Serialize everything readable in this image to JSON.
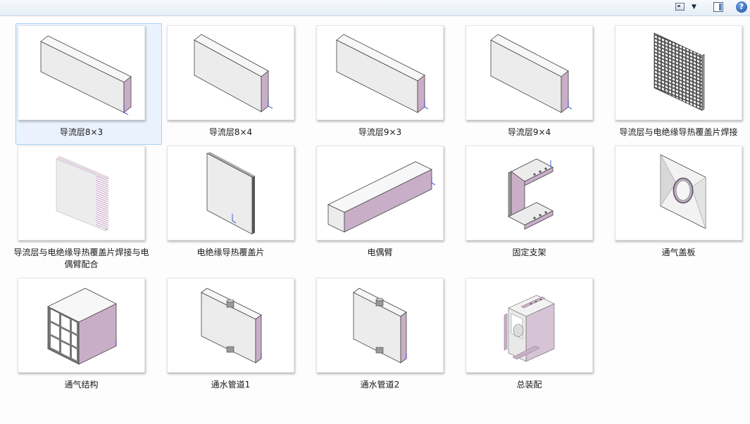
{
  "toolbar": {
    "view_icon": "views-icon",
    "dropdown_icon": "chevron-down-icon",
    "pane_icon": "preview-pane-icon",
    "help_icon": "help-icon",
    "help_text": "?"
  },
  "files": [
    {
      "name": "导流层8×3",
      "icon": "panel-thumbnail",
      "selected": true
    },
    {
      "name": "导流层8×4",
      "icon": "panel-thumbnail"
    },
    {
      "name": "导流层9×3",
      "icon": "panel-thumbnail"
    },
    {
      "name": "导流层9×4",
      "icon": "panel-thumbnail"
    },
    {
      "name": "导流层与电绝缘导热覆盖片焊接",
      "icon": "grid-panel-thumbnail"
    },
    {
      "name": "导流层与电绝缘导热覆盖片焊接与电偶臂配合",
      "icon": "stacked-panel-thumbnail"
    },
    {
      "name": "电绝缘导热覆盖片",
      "icon": "thin-plate-thumbnail"
    },
    {
      "name": "电偶臂",
      "icon": "long-bar-thumbnail"
    },
    {
      "name": "固定支架",
      "icon": "bracket-thumbnail"
    },
    {
      "name": "通气盖板",
      "icon": "vent-cover-thumbnail"
    },
    {
      "name": "通气结构",
      "icon": "vent-structure-thumbnail"
    },
    {
      "name": "通水管道1",
      "icon": "water-pipe-thumbnail"
    },
    {
      "name": "通水管道2",
      "icon": "water-pipe-thumbnail"
    },
    {
      "name": "总装配",
      "icon": "assembly-thumbnail"
    }
  ]
}
